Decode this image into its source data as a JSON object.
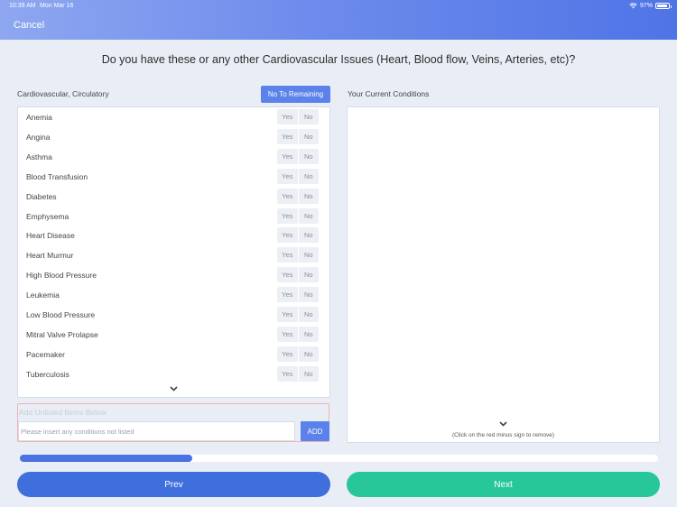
{
  "status_bar": {
    "time": "10:39 AM",
    "date": "Mon Mar 16",
    "battery": "97%",
    "icons": [
      "wifi-icon",
      "battery-icon"
    ]
  },
  "header": {
    "cancel_label": "Cancel"
  },
  "question": "Do you have these or any other Cardiovascular Issues (Heart, Blood flow, Veins, Arteries, etc)?",
  "left_panel": {
    "title": "Cardiovascular, Circulatory",
    "no_to_remaining_label": "No To Remaining",
    "yes_label": "Yes",
    "no_label": "No",
    "items": [
      "Anemia",
      "Angina",
      "Asthma",
      "Blood Transfusion",
      "Diabetes",
      "Emphysema",
      "Heart Disease",
      "Heart Murmur",
      "High Blood Pressure",
      "Leukemia",
      "Low Blood Pressure",
      "Mitral Valve Prolapse",
      "Pacemaker",
      "Tuberculosis"
    ]
  },
  "add_section": {
    "label": "Add Unlisted Items Below",
    "placeholder": "Please insert any conditions not listed",
    "button_label": "ADD"
  },
  "right_panel": {
    "title": "Your Current Conditions",
    "hint": "(Click on the red minus sign to remove)"
  },
  "progress": {
    "fraction": 0.27
  },
  "footer": {
    "prev_label": "Prev",
    "next_label": "Next"
  },
  "colors": {
    "accent": "#5b82ea",
    "prev": "#3f6fdc",
    "next": "#27c79a",
    "progress": "#4a72e0"
  }
}
